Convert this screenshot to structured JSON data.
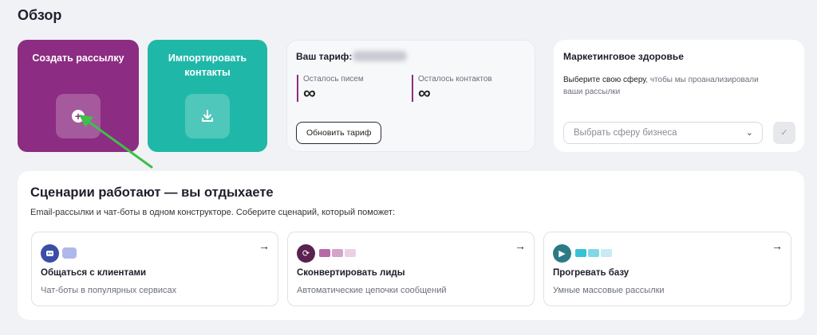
{
  "page": {
    "title": "Обзор"
  },
  "tiles": {
    "create": {
      "label": "Создать рассылку",
      "icon": "plus-circle-icon",
      "color": "#8c2c82"
    },
    "import": {
      "label": "Импортировать контакты",
      "icon": "download-icon",
      "color": "#1fb8a8"
    }
  },
  "tariff": {
    "title": "Ваш тариф:",
    "stats": [
      {
        "label": "Осталось писем",
        "value": "∞"
      },
      {
        "label": "Осталось контактов",
        "value": "∞"
      }
    ],
    "upgrade_label": "Обновить тариф"
  },
  "health": {
    "title": "Маркетинговое здоровье",
    "desc_strong": "Выберите свою сферу",
    "desc_rest": ", чтобы мы проанализировали ваши рассылки",
    "select_placeholder": "Выбрать сферу бизнеса",
    "ok_icon": "check-icon"
  },
  "scenarios": {
    "title": "Сценарии работают — вы отдыхаете",
    "subtitle": "Email-рассылки и чат-боты в одном конструкторе. Соберите сценарий, который поможет:",
    "items": [
      {
        "name": "Общаться с клиентами",
        "desc": "Чат-боты в популярных сервисах",
        "icon": "chatbot-icon",
        "accent": "#3a4ea5"
      },
      {
        "name": "Сконвертировать лиды",
        "desc": "Автоматические цепочки сообщений",
        "icon": "refresh-icon",
        "accent": "#5b2150"
      },
      {
        "name": "Прогревать базу",
        "desc": "Умные массовые рассылки",
        "icon": "play-icon",
        "accent": "#2b7a86"
      }
    ]
  }
}
